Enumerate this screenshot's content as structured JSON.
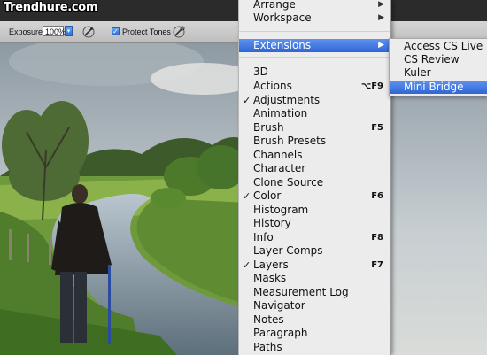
{
  "watermark": "Trendhure.com",
  "options_bar": {
    "exposure_label": "Exposure:",
    "exposure_value": "100%",
    "protect_tones_label": "Protect Tones",
    "protect_tones_checked": true,
    "icons": [
      "airbrush-icon",
      "pressure-icon"
    ]
  },
  "menu": {
    "items": [
      {
        "label": "Arrange",
        "submenu": true
      },
      {
        "label": "Workspace",
        "submenu": true
      },
      {
        "label": "Extensions",
        "submenu": true,
        "highlighted": true
      },
      {
        "label": "3D"
      },
      {
        "label": "Actions",
        "shortcut": "⌥F9"
      },
      {
        "label": "Adjustments",
        "checked": true
      },
      {
        "label": "Animation"
      },
      {
        "label": "Brush",
        "shortcut": "F5"
      },
      {
        "label": "Brush Presets"
      },
      {
        "label": "Channels"
      },
      {
        "label": "Character"
      },
      {
        "label": "Clone Source"
      },
      {
        "label": "Color",
        "checked": true,
        "shortcut": "F6"
      },
      {
        "label": "Histogram"
      },
      {
        "label": "History"
      },
      {
        "label": "Info",
        "shortcut": "F8"
      },
      {
        "label": "Layer Comps"
      },
      {
        "label": "Layers",
        "checked": true,
        "shortcut": "F7"
      },
      {
        "label": "Masks"
      },
      {
        "label": "Measurement Log"
      },
      {
        "label": "Navigator"
      },
      {
        "label": "Notes"
      },
      {
        "label": "Paragraph"
      },
      {
        "label": "Paths"
      }
    ]
  },
  "extensions_submenu": {
    "items": [
      {
        "label": "Access CS Live"
      },
      {
        "label": "CS Review"
      },
      {
        "label": "Kuler"
      },
      {
        "label": "Mini Bridge",
        "highlighted": true
      }
    ]
  },
  "colors": {
    "highlight": "#3a6fdc",
    "menu_bg": "#ececec"
  }
}
